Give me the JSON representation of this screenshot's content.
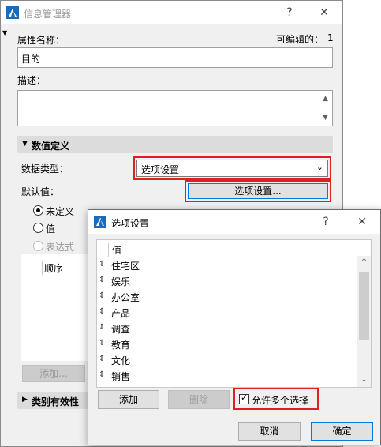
{
  "main": {
    "title": "信息管理器",
    "help": "?",
    "close": "✕",
    "name_label": "属性名称：",
    "editable_label": "可编辑的：",
    "editable_count": "1",
    "name_value": "目的",
    "desc_label": "描述：",
    "desc_value": "",
    "section_value_def": "数值定义",
    "data_type_label": "数据类型：",
    "data_type_value": "选项设置",
    "default_label": "默认值：",
    "option_button": "选项设置...",
    "radio_undefined": "未定义",
    "radio_value": "值",
    "radio_expr": "表达式",
    "order_label": "顺序",
    "add_button": "添加...",
    "section_category": "类别有效性"
  },
  "dialog": {
    "title": "选项设置",
    "help": "?",
    "close": "✕",
    "list_header": "值",
    "items": [
      "住宅区",
      "娱乐",
      "办公室",
      "产品",
      "调查",
      "教育",
      "文化",
      "销售"
    ],
    "add_button": "添加",
    "delete_button": "删除",
    "multi_select_label": "允许多个选择",
    "multi_select_checked": true,
    "cancel_button": "取消",
    "ok_button": "确定"
  },
  "colors": {
    "highlight_border": "#e02020",
    "focus_border": "#0078d7",
    "app_icon": "#1c6bb8"
  }
}
